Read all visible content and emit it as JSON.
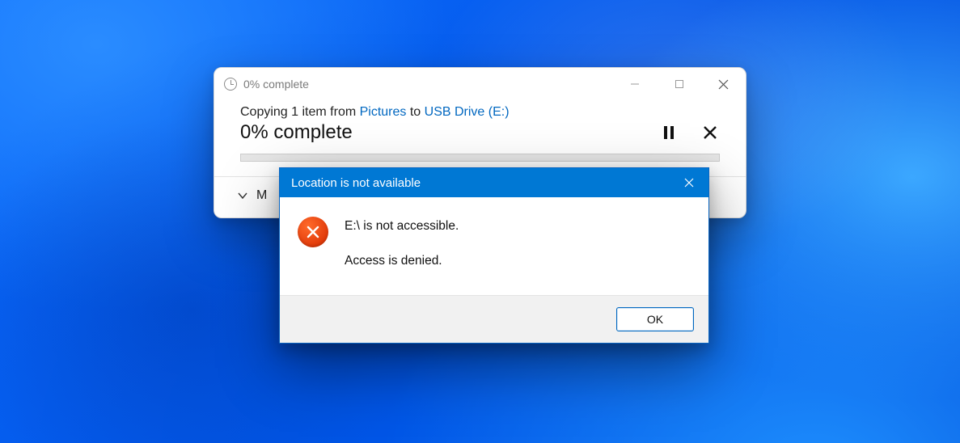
{
  "copy_dialog": {
    "title": "0% complete",
    "desc_prefix": "Copying 1 item from ",
    "desc_source": "Pictures",
    "desc_middle": " to ",
    "desc_dest": "USB Drive (E:)",
    "status": "0% complete",
    "more_details": "More details",
    "more_details_shown": "M"
  },
  "error_dialog": {
    "title": "Location is not available",
    "line1": "E:\\ is not accessible.",
    "line2": "Access is denied.",
    "ok": "OK"
  },
  "icons": {
    "minimize": "minimize-icon",
    "maximize": "maximize-icon",
    "close": "close-icon",
    "pause": "pause-icon",
    "cancel": "cancel-icon",
    "error": "error-icon",
    "chevron_down": "chevron-down-icon",
    "clock": "clock-icon"
  },
  "colors": {
    "link": "#0067c0",
    "titlebar": "#0078d4",
    "error_icon": "#e23b0a"
  }
}
